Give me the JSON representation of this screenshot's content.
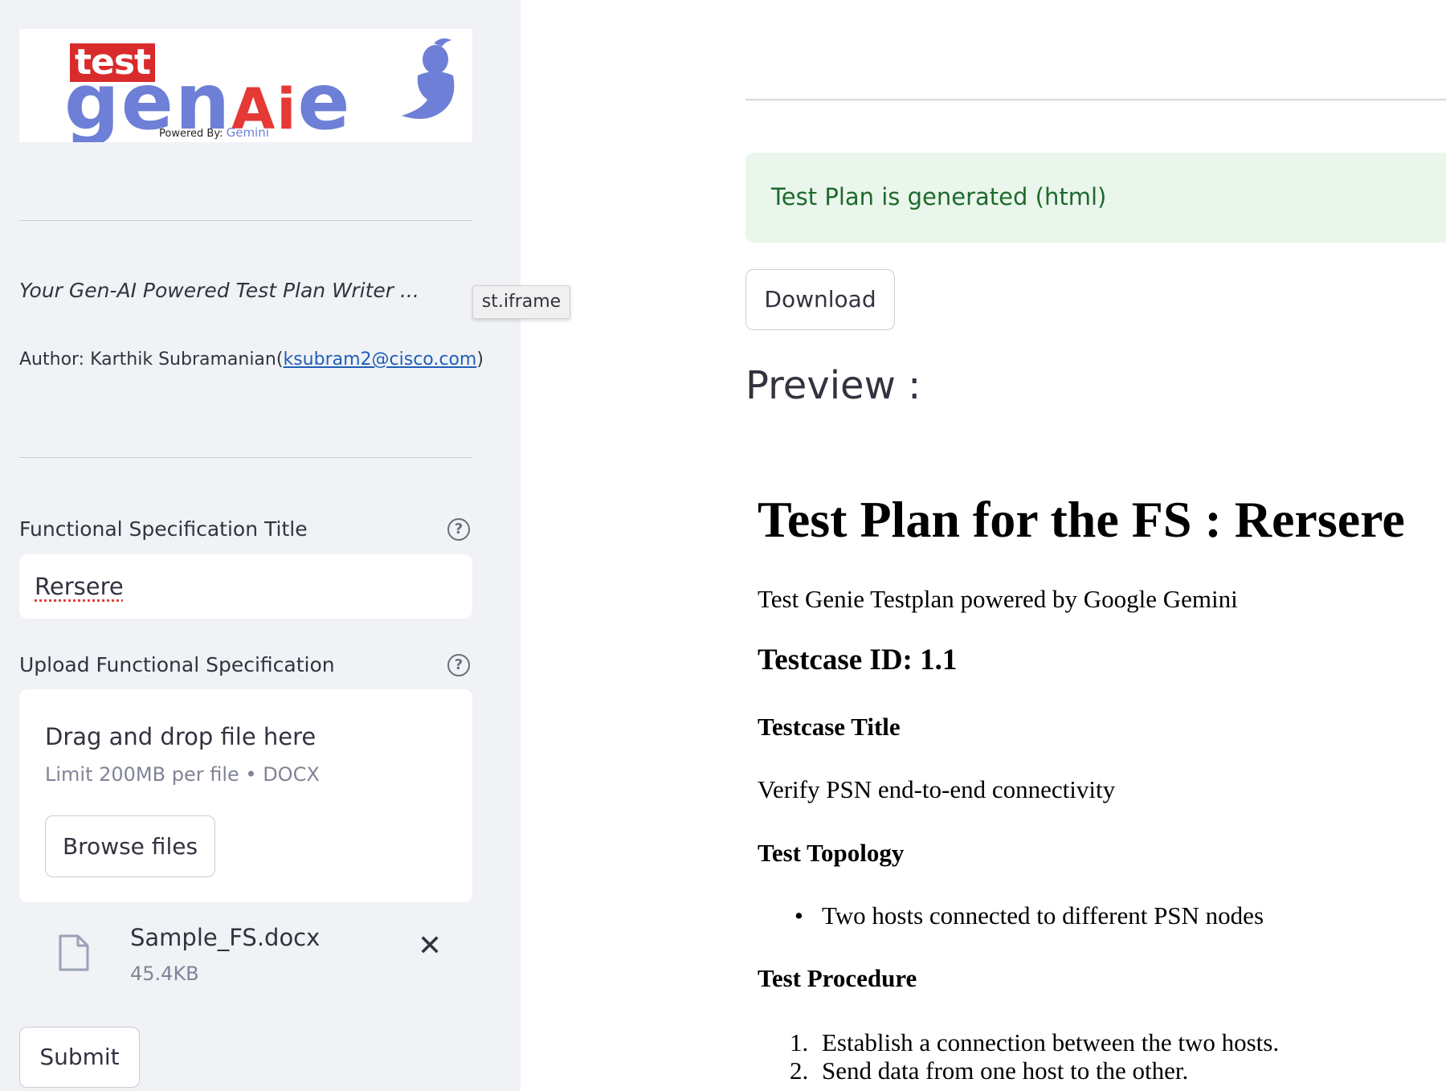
{
  "sidebar": {
    "logo": {
      "word_test": "test",
      "word_gen": "gen",
      "word_ai": "Ai",
      "word_e": "e",
      "powered_by": "Powered By:",
      "gemini": "Gemini"
    },
    "tagline": "Your Gen-AI Powered Test Plan Writer ...",
    "author_prefix": "Author: Karthik Subramanian(",
    "author_email": "ksubram2@cisco.com",
    "author_suffix": ")",
    "tooltip": "st.iframe",
    "fs_title_label": "Functional Specification Title",
    "fs_title_value": "Rersere",
    "upload_label": "Upload Functional Specification",
    "dropzone_title": "Drag and drop file here",
    "dropzone_limit": "Limit 200MB per file • DOCX",
    "browse_label": "Browse files",
    "file_name": "Sample_FS.docx",
    "file_size": "45.4KB",
    "submit_label": "Submit"
  },
  "main": {
    "success_message": "Test Plan is generated (html)",
    "download_label": "Download",
    "preview_label": "Preview :",
    "doc": {
      "title": "Test Plan for the FS : Rersere",
      "subtitle": "Test Genie Testplan powered by Google Gemini",
      "testcase_id": "Testcase ID: 1.1",
      "testcase_title_heading": "Testcase Title",
      "testcase_title": "Verify PSN end-to-end connectivity",
      "topology_heading": "Test Topology",
      "topology_items": [
        "Two hosts connected to different PSN nodes"
      ],
      "procedure_heading": "Test Procedure",
      "procedure_items": [
        "Establish a connection between the two hosts.",
        "Send data from one host to the other."
      ]
    }
  },
  "colors": {
    "sidebar_bg": "#f0f2f6",
    "success_bg": "#eaf6ec",
    "success_text": "#1e6a2c",
    "link": "#1f5fb8",
    "logo_red": "#d92b2b",
    "logo_blue": "#6d7fd6"
  }
}
